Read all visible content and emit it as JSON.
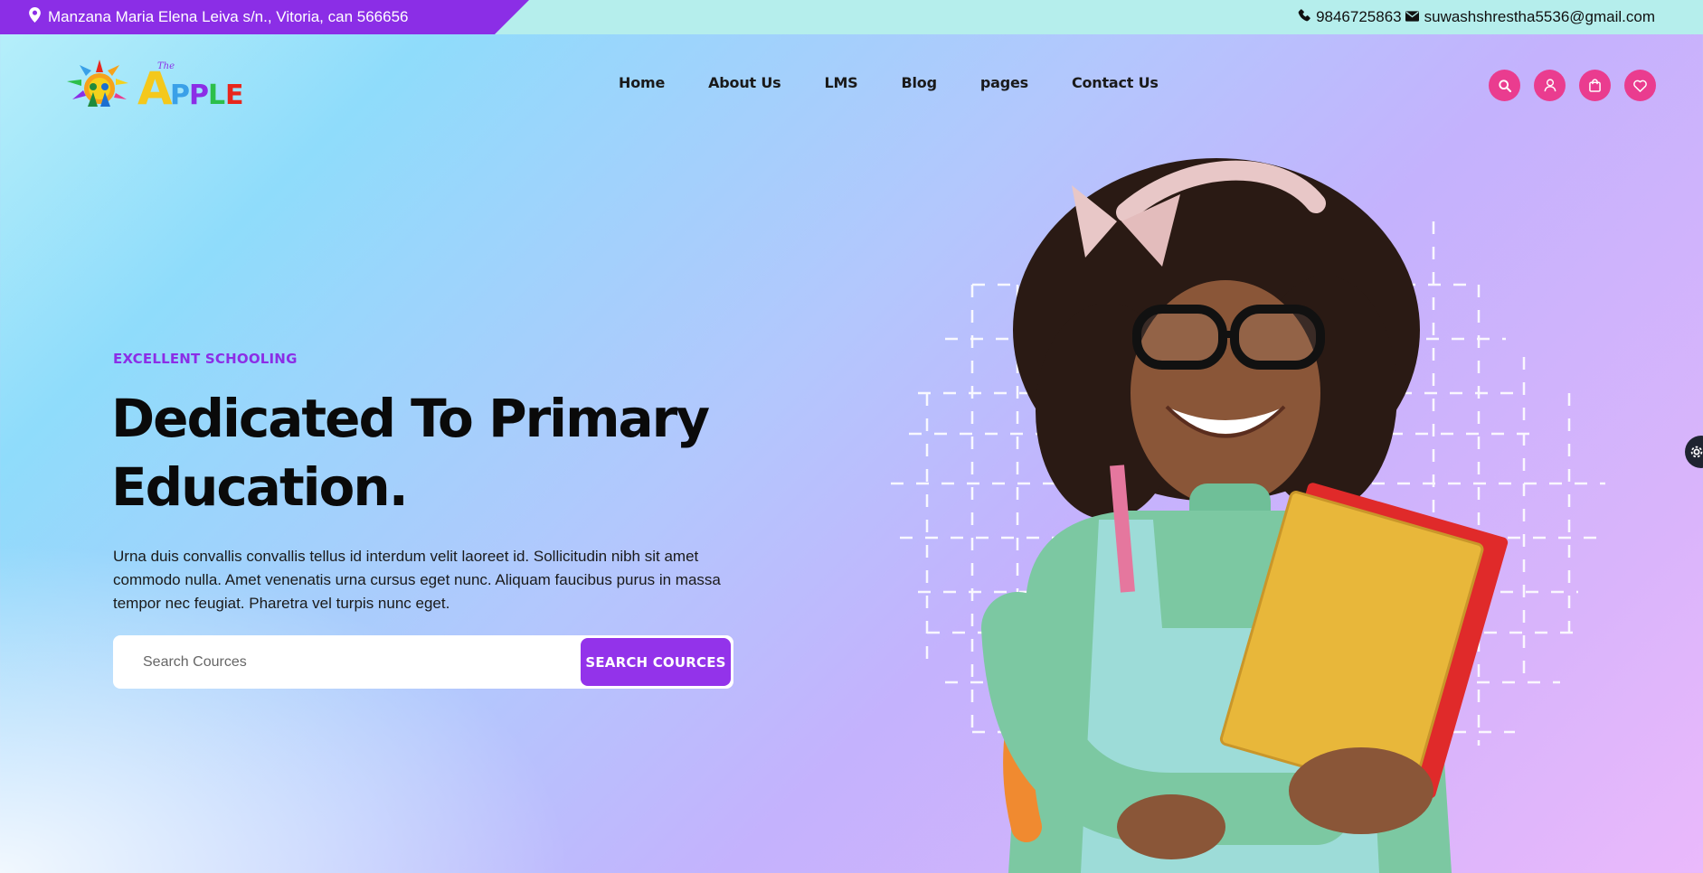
{
  "topbar": {
    "address": "Manzana Maria Elena Leiva s/n., Vitoria, can 566656",
    "phone": "9846725863",
    "email": "suwashshrestha5536@gmail.com"
  },
  "logo": {
    "brand": "APPLE",
    "tagline": "The"
  },
  "nav": {
    "items": [
      "Home",
      "About Us",
      "LMS",
      "Blog",
      "pages",
      "Contact Us"
    ]
  },
  "header_icons": [
    "search-icon",
    "user-icon",
    "bag-icon",
    "heart-icon"
  ],
  "hero": {
    "eyebrow": "EXCELLENT SCHOOLING",
    "headline_line1": "Dedicated To Primary",
    "headline_line2": "Education.",
    "description": "Urna duis convallis convallis tellus id interdum velit laoreet id. Sollicitudin nibh sit amet commodo nulla. Amet venenatis urna cursus eget nunc. Aliquam faucibus purus in massa tempor nec feugiat. Pharetra vel turpis nunc eget.",
    "search_placeholder": "Search Cources",
    "search_button": "SEARCH COURCES"
  },
  "colors": {
    "accent_purple": "#8b2ee6",
    "accent_pink": "#ea3c8f",
    "topbar_bg": "#b5eeec"
  }
}
